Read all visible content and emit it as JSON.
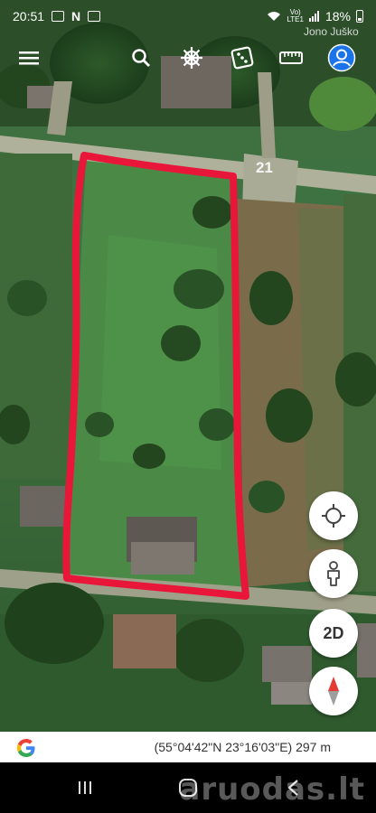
{
  "status_bar": {
    "time": "20:51",
    "n_icon_label": "N",
    "network_top": "Vo)",
    "network_bottom": "LTE1",
    "battery_percent": "18%"
  },
  "toolbar": {
    "menu_icon": "hamburger-menu-icon",
    "search_icon": "search-icon",
    "voyager_icon": "ship-wheel-icon",
    "feeling_lucky_icon": "dice-icon",
    "measure_icon": "ruler-icon",
    "account_icon": "account-icon"
  },
  "map": {
    "place_label": "Jono Juško",
    "house_number": "21",
    "parcel_outline_color": "#e8173a"
  },
  "controls": {
    "my_location_icon": "crosshair-icon",
    "street_view_icon": "pegman-icon",
    "view_mode_label": "2D",
    "compass_icon": "compass-icon"
  },
  "info_bar": {
    "logo_icon": "google-g-icon",
    "coordinates": "(55°04'42\"N 23°16'03\"E) 297 m"
  },
  "nav_bar": {
    "recents_icon": "recents-icon",
    "home_icon": "home-icon",
    "back_icon": "back-icon",
    "watermark": "aruodas.lt"
  }
}
